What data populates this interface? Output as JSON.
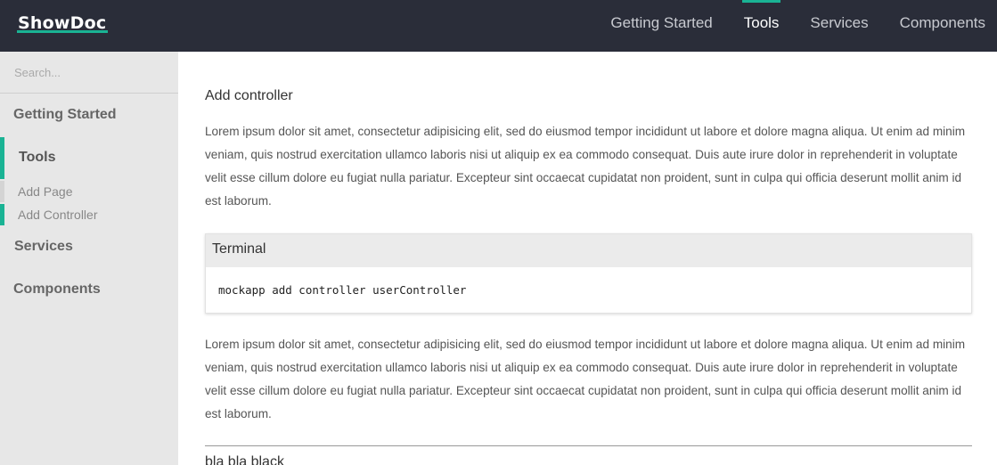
{
  "app": {
    "logo": "ShowDoc"
  },
  "nav": {
    "items": [
      {
        "label": "Getting Started"
      },
      {
        "label": "Tools"
      },
      {
        "label": "Services"
      },
      {
        "label": "Components"
      }
    ],
    "active": "Tools"
  },
  "sidebar": {
    "search_placeholder": "Search...",
    "items": [
      {
        "label": "Getting Started"
      },
      {
        "label": "Tools"
      },
      {
        "label": "Services"
      },
      {
        "label": "Components"
      }
    ],
    "sub_items": [
      {
        "label": "Add Page"
      },
      {
        "label": "Add Controller"
      }
    ],
    "active_section": "Tools",
    "active_sub_item": "Add Controller"
  },
  "main": {
    "heading": "Add controller",
    "paragraph1": "Lorem ipsum dolor sit amet, consectetur adipisicing elit, sed do eiusmod tempor incididunt ut labore et dolore magna aliqua. Ut enim ad minim veniam, quis nostrud exercitation ullamco laboris nisi ut aliquip ex ea commodo consequat. Duis aute irure dolor in reprehenderit in voluptate velit esse cillum dolore eu fugiat nulla pariatur. Excepteur sint occaecat cupidatat non proident, sunt in culpa qui officia deserunt mollit anim id est laborum.",
    "terminal": {
      "title": "Terminal",
      "code": "mockapp add controller userController"
    },
    "paragraph2": "Lorem ipsum dolor sit amet, consectetur adipisicing elit, sed do eiusmod tempor incididunt ut labore et dolore magna aliqua. Ut enim ad minim veniam, quis nostrud exercitation ullamco laboris nisi ut aliquip ex ea commodo consequat. Duis aute irure dolor in reprehenderit in voluptate velit esse cillum dolore eu fugiat nulla pariatur. Excepteur sint occaecat cupidatat non proident, sunt in culpa qui officia deserunt mollit anim id est laborum.",
    "next_heading": "bla bla black"
  },
  "colors": {
    "topbar": "#2a2d39",
    "accent": "#1ab394",
    "sidebar": "#e7e7e7"
  }
}
